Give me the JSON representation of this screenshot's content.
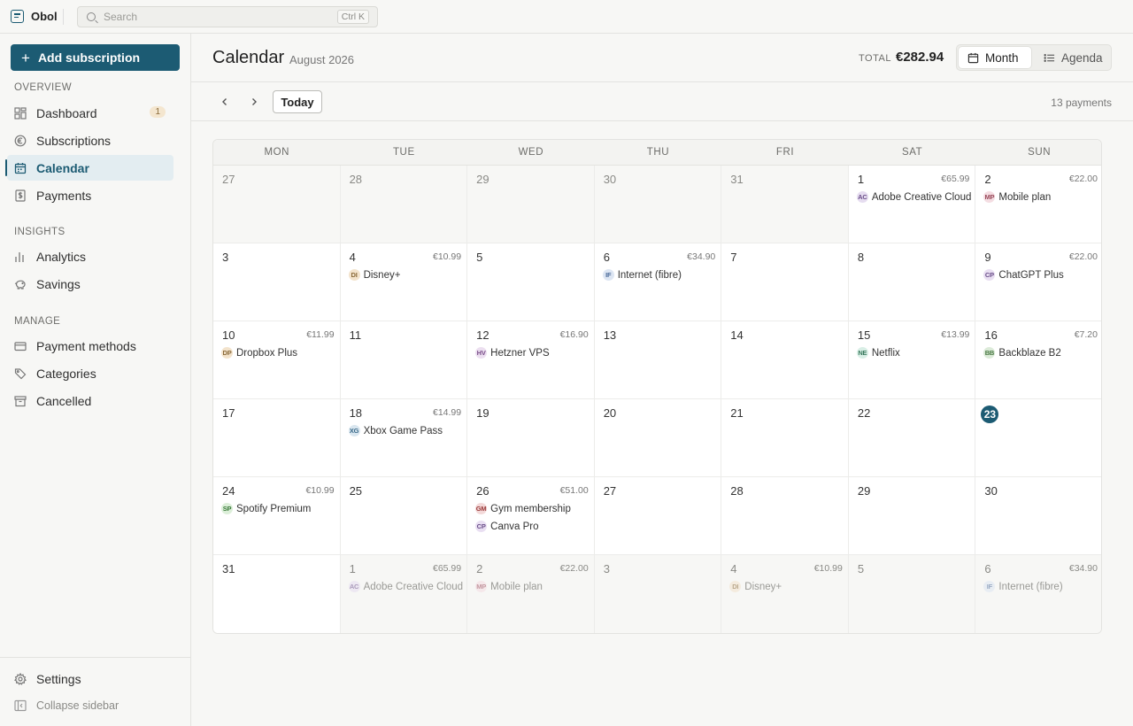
{
  "brand": {
    "name": "Obol"
  },
  "search": {
    "placeholder": "Search",
    "shortcut": "Ctrl K"
  },
  "sidebar": {
    "add_label": "Add subscription",
    "sections": {
      "overview": "OVERVIEW",
      "insights": "INSIGHTS",
      "manage": "MANAGE"
    },
    "items": {
      "dashboard": "Dashboard",
      "dashboard_badge": "1",
      "subscriptions": "Subscriptions",
      "calendar": "Calendar",
      "payments": "Payments",
      "analytics": "Analytics",
      "savings": "Savings",
      "payment_methods": "Payment methods",
      "categories": "Categories",
      "cancelled": "Cancelled",
      "settings": "Settings",
      "collapse": "Collapse sidebar"
    }
  },
  "header": {
    "title": "Calendar",
    "subtitle": "August 2026",
    "total_label": "TOTAL",
    "total_value": "€282.94",
    "view_month": "Month",
    "view_agenda": "Agenda"
  },
  "toolbar": {
    "prev": "‹",
    "next": "›",
    "today": "Today",
    "count": "13 payments"
  },
  "calendar": {
    "weekdays": [
      "MON",
      "TUE",
      "WED",
      "THU",
      "FRI",
      "SAT",
      "SUN"
    ],
    "today": "23",
    "chip_colors": {
      "AC": [
        "#e6ddf0",
        "#6b4f8a"
      ],
      "MP": [
        "#f4dde2",
        "#9a4b5c"
      ],
      "DI": [
        "#f3e3cc",
        "#8a6a3a"
      ],
      "IF": [
        "#dde6f3",
        "#4b6a9a"
      ],
      "CP": [
        "#e9dff2",
        "#6b4f8a"
      ],
      "DP": [
        "#f3e3cc",
        "#8a6a3a"
      ],
      "HV": [
        "#ecdff0",
        "#7a4f8a"
      ],
      "NE": [
        "#d9efe6",
        "#3a7a5e"
      ],
      "BB": [
        "#dcebd9",
        "#4a7a44"
      ],
      "XG": [
        "#d9e6ef",
        "#3a6a8a"
      ],
      "SP": [
        "#dcefd9",
        "#3a7a3a"
      ],
      "GM": [
        "#f3d9d9",
        "#9a3a3a"
      ]
    },
    "weeks": [
      [
        {
          "day": "27",
          "out": true
        },
        {
          "day": "28",
          "out": true
        },
        {
          "day": "29",
          "out": true
        },
        {
          "day": "30",
          "out": true
        },
        {
          "day": "31",
          "out": true
        },
        {
          "day": "1",
          "amount": "€65.99",
          "events": [
            {
              "code": "AC",
              "name": "Adobe Creative Cloud"
            }
          ]
        },
        {
          "day": "2",
          "amount": "€22.00",
          "events": [
            {
              "code": "MP",
              "name": "Mobile plan"
            }
          ]
        }
      ],
      [
        {
          "day": "3"
        },
        {
          "day": "4",
          "amount": "€10.99",
          "events": [
            {
              "code": "DI",
              "name": "Disney+"
            }
          ]
        },
        {
          "day": "5"
        },
        {
          "day": "6",
          "amount": "€34.90",
          "events": [
            {
              "code": "IF",
              "name": "Internet (fibre)"
            }
          ]
        },
        {
          "day": "7"
        },
        {
          "day": "8"
        },
        {
          "day": "9",
          "amount": "€22.00",
          "events": [
            {
              "code": "CP",
              "name": "ChatGPT Plus"
            }
          ]
        }
      ],
      [
        {
          "day": "10",
          "amount": "€11.99",
          "events": [
            {
              "code": "DP",
              "name": "Dropbox Plus"
            }
          ]
        },
        {
          "day": "11"
        },
        {
          "day": "12",
          "amount": "€16.90",
          "events": [
            {
              "code": "HV",
              "name": "Hetzner VPS"
            }
          ]
        },
        {
          "day": "13"
        },
        {
          "day": "14"
        },
        {
          "day": "15",
          "amount": "€13.99",
          "events": [
            {
              "code": "NE",
              "name": "Netflix"
            }
          ]
        },
        {
          "day": "16",
          "amount": "€7.20",
          "events": [
            {
              "code": "BB",
              "name": "Backblaze B2"
            }
          ]
        }
      ],
      [
        {
          "day": "17"
        },
        {
          "day": "18",
          "amount": "€14.99",
          "events": [
            {
              "code": "XG",
              "name": "Xbox Game Pass"
            }
          ]
        },
        {
          "day": "19"
        },
        {
          "day": "20"
        },
        {
          "day": "21"
        },
        {
          "day": "22"
        },
        {
          "day": "23",
          "today": true
        }
      ],
      [
        {
          "day": "24",
          "amount": "€10.99",
          "events": [
            {
              "code": "SP",
              "name": "Spotify Premium"
            }
          ]
        },
        {
          "day": "25"
        },
        {
          "day": "26",
          "amount": "€51.00",
          "events": [
            {
              "code": "GM",
              "name": "Gym membership"
            },
            {
              "code": "CP",
              "name": "Canva Pro"
            }
          ]
        },
        {
          "day": "27"
        },
        {
          "day": "28"
        },
        {
          "day": "29"
        },
        {
          "day": "30"
        }
      ],
      [
        {
          "day": "31"
        },
        {
          "day": "1",
          "out": true,
          "amount": "€65.99",
          "events": [
            {
              "code": "AC",
              "name": "Adobe Creative Cloud"
            }
          ]
        },
        {
          "day": "2",
          "out": true,
          "amount": "€22.00",
          "events": [
            {
              "code": "MP",
              "name": "Mobile plan"
            }
          ]
        },
        {
          "day": "3",
          "out": true
        },
        {
          "day": "4",
          "out": true,
          "amount": "€10.99",
          "events": [
            {
              "code": "DI",
              "name": "Disney+"
            }
          ]
        },
        {
          "day": "5",
          "out": true
        },
        {
          "day": "6",
          "out": true,
          "amount": "€34.90",
          "events": [
            {
              "code": "IF",
              "name": "Internet (fibre)"
            }
          ]
        }
      ]
    ]
  }
}
